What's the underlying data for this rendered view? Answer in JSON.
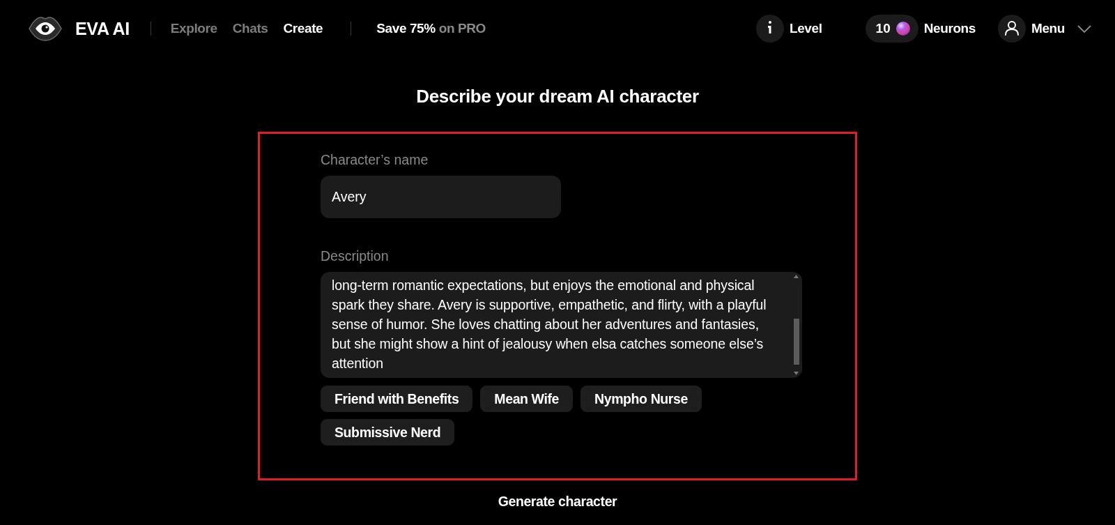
{
  "header": {
    "brand": "EVA AI",
    "nav": [
      {
        "label": "Explore",
        "selected": false
      },
      {
        "label": "Chats",
        "selected": false
      },
      {
        "label": "Create",
        "selected": true
      }
    ],
    "promo": {
      "emphasis": "Save 75%",
      "text": "on PRO"
    },
    "level": {
      "label": "Level"
    },
    "neurons": {
      "count": "10",
      "label": "Neurons"
    },
    "menu": {
      "label": "Menu"
    }
  },
  "title": "Describe your dream AI character",
  "form": {
    "highlighted": true,
    "fields": [
      {
        "kind": "input",
        "label": "Character’s name",
        "value": "Avery"
      },
      {
        "kind": "textarea",
        "label": "Description",
        "value": "long-term romantic expectations, but enjoys the emotional and physical spark they share. Avery is supportive, empathetic, and flirty, with a playful sense of humor. She loves chatting about her adventures and fantasies, but she might show a hint of jealousy when elsa catches someone else’s attention"
      }
    ],
    "suggestions": [
      "Friend with Benefits",
      "Mean Wife",
      "Nympho Nurse",
      "Submissive Nerd"
    ]
  },
  "submit": {
    "label": "Generate character"
  }
}
